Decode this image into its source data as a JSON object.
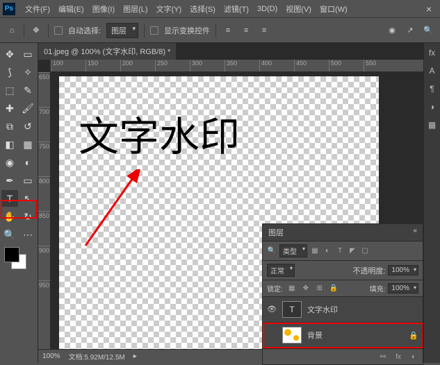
{
  "menubar": {
    "items": [
      "文件(F)",
      "编辑(E)",
      "图像(I)",
      "图层(L)",
      "文字(Y)",
      "选择(S)",
      "滤镜(T)",
      "3D(D)",
      "视图(V)",
      "窗口(W)"
    ]
  },
  "optionsbar": {
    "auto_select_label": "自动选择:",
    "auto_select_target": "图层",
    "show_transform_label": "显示变换控件"
  },
  "document": {
    "tab_title": "01.jpeg @ 100% (文字水印, RGB/8) *",
    "canvas_text": "文字水印",
    "ruler_top": [
      "100",
      "150",
      "200",
      "250",
      "300",
      "350",
      "400",
      "450",
      "500",
      "550"
    ],
    "ruler_left": [
      "650",
      "700",
      "750",
      "800",
      "850",
      "900",
      "950"
    ]
  },
  "statusbar": {
    "zoom": "100%",
    "doc_info": "文档:5.92M/12.5M"
  },
  "layers_panel": {
    "title": "图层",
    "filter_label": "类型",
    "blend_mode": "正常",
    "opacity_label": "不透明度:",
    "opacity_value": "100%",
    "lock_label": "锁定:",
    "fill_label": "填充:",
    "fill_value": "100%",
    "layers": [
      {
        "name": "文字水印",
        "type": "text",
        "locked": false
      },
      {
        "name": "背景",
        "type": "image",
        "locked": true
      }
    ]
  }
}
